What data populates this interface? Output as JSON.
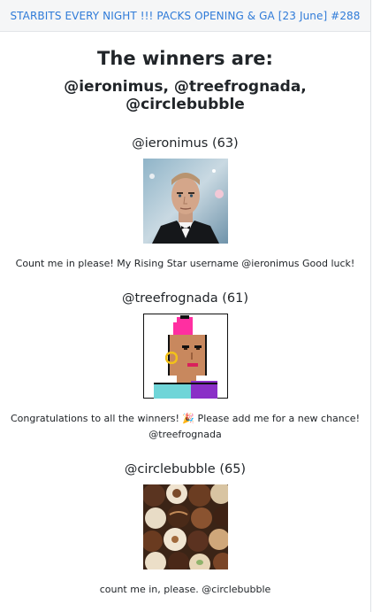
{
  "topbar": {
    "link_text": "STARBITS EVERY NIGHT !!! PACKS OPENING & GA [23 June] #288"
  },
  "main": {
    "title": "The winners are:",
    "winners_line": "@ieronimus, @treefrognada, @circlebubble"
  },
  "entries": [
    {
      "heading": "@ieronimus (63)",
      "avatar_icon": "man-in-tuxedo-portrait",
      "comment": "Count me in please! My Rising Star username @ieronimus Good luck!"
    },
    {
      "heading": "@treefrognada (61)",
      "avatar_icon": "pixel-art-punk-avatar",
      "comment": "Congratulations to all the winners! 🎉 Please add me for a new chance! @treefrognada"
    },
    {
      "heading": "@circlebubble (65)",
      "avatar_icon": "chocolate-pralines-photo",
      "comment": "count me in, please. @circlebubble"
    }
  ],
  "colors": {
    "link": "#2f7bd8",
    "topbar_bg": "#f5f6f7",
    "text": "#212529"
  }
}
